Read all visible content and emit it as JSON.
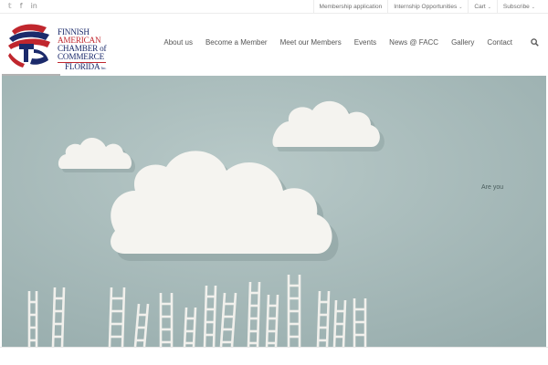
{
  "topbar": {
    "social": [
      {
        "icon": "twitter-icon",
        "glyph": "𝕥"
      },
      {
        "icon": "facebook-icon",
        "glyph": "f"
      },
      {
        "icon": "linkedin-icon",
        "glyph": "in"
      }
    ],
    "links": [
      {
        "label": "Membership application",
        "dropdown": false
      },
      {
        "label": "Internship Opportunities",
        "dropdown": true
      },
      {
        "label": "Cart",
        "dropdown": true
      },
      {
        "label": "Subscribe",
        "dropdown": true
      }
    ]
  },
  "logo": {
    "line1": "FINNISH",
    "line2": "AMERICAN",
    "line3": "CHAMBER of",
    "line4": "COMMERCE",
    "line5": "FLORIDA",
    "inc": "Inc."
  },
  "nav": {
    "items": [
      "About us",
      "Become a Member",
      "Meet our Members",
      "Events",
      "News @ FACC",
      "Gallery",
      "Contact"
    ],
    "search_icon": "search-icon"
  },
  "hero": {
    "caption": "Are you"
  },
  "colors": {
    "logo_blue": "#1b2a6b",
    "logo_red": "#c0262d",
    "hero_bg": "#a9bcbc"
  }
}
